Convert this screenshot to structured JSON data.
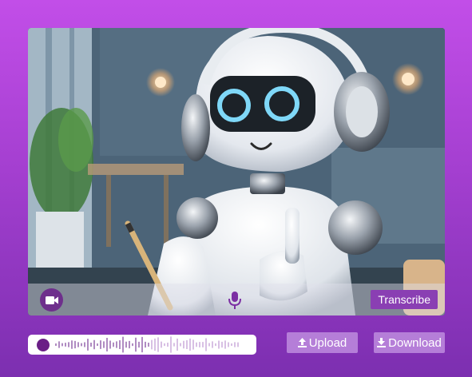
{
  "video": {
    "description_alt": "",
    "transcribe_label": "Transcribe"
  },
  "controls": {
    "camera_icon": "video-camera-icon",
    "mic_icon": "microphone-icon"
  },
  "recorder": {
    "record_icon": "record-dot-icon",
    "waveform_icon": "audio-waveform-icon"
  },
  "actions": {
    "upload_label": "Upload",
    "download_label": "Download",
    "upload_icon": "upload-arrow-icon",
    "download_icon": "download-arrow-icon"
  },
  "colors": {
    "background_top": "#c24ee8",
    "background_bottom": "#7c2fb0",
    "accent_dark": "#6e2f8c",
    "button_light": "#b57ed8",
    "transcribe_bg": "#8a3fb3"
  }
}
